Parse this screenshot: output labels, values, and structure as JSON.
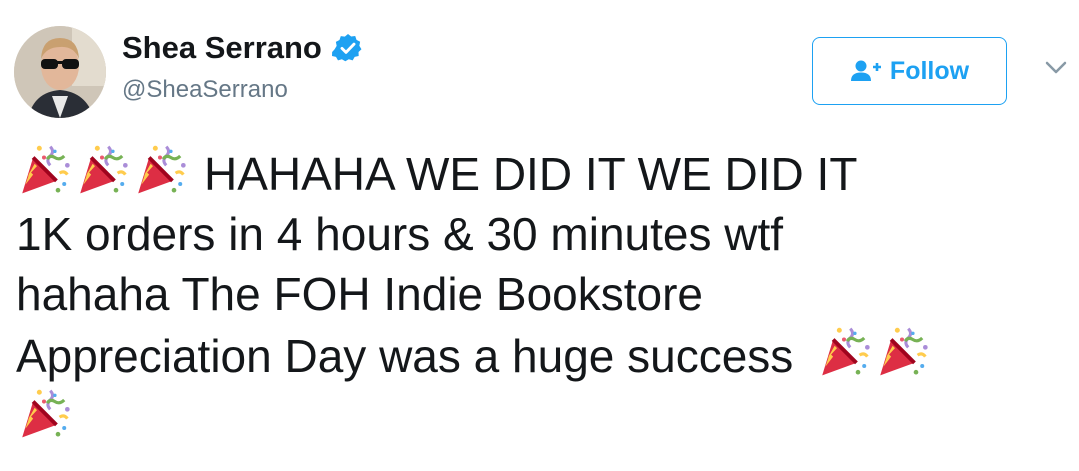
{
  "user": {
    "display_name": "Shea Serrano",
    "handle": "@SheaSerrano",
    "verified": true
  },
  "follow_button": {
    "label": "Follow"
  },
  "tweet": {
    "line1": "HAHAHA WE DID IT WE DID IT",
    "line2": "1K orders in 4 hours & 30 minutes wtf",
    "line3": "hahaha The FOH Indie Bookstore",
    "line4": "Appreciation Day was a huge success",
    "emoji": "party-popper"
  },
  "colors": {
    "accent": "#1da1f2",
    "text": "#14171a",
    "muted": "#657786"
  }
}
